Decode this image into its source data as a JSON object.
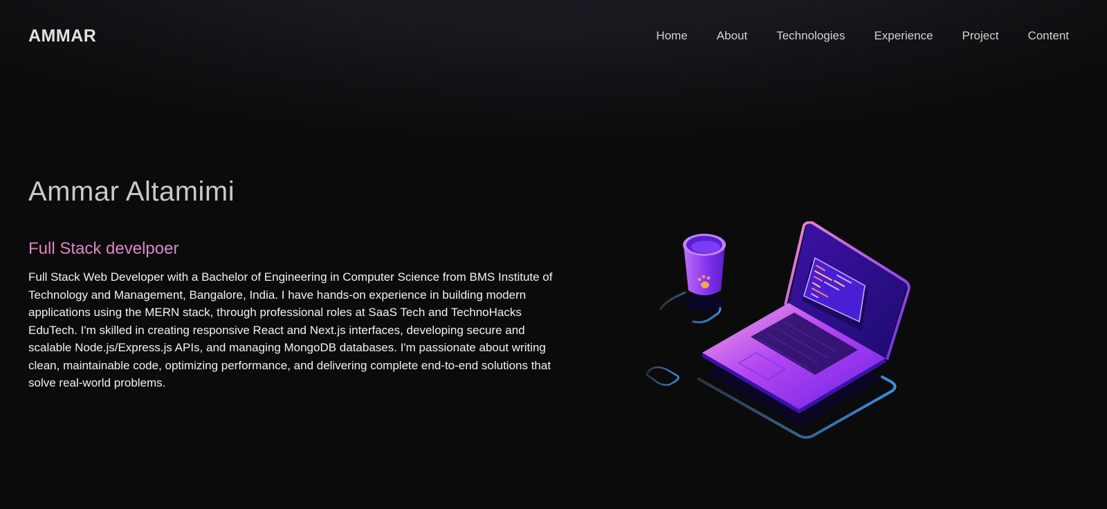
{
  "nav": {
    "brand": "AMMAR",
    "links": [
      "Home",
      "About",
      "Technologies",
      "Experience",
      "Project",
      "Content"
    ]
  },
  "hero": {
    "name": "Ammar Altamimi",
    "role": "Full Stack develpoer",
    "bio": "Full Stack Web Developer with a Bachelor of Engineering in Computer Science from BMS Institute of Technology and Management, Bangalore, India. I have hands-on experience in building modern applications using the MERN stack, through professional roles at SaaS Tech and TechnoHacks EduTech. I'm skilled in creating responsive React and Next.js interfaces, developing secure and scalable Node.js/Express.js APIs, and managing MongoDB databases. I'm passionate about writing clean, maintainable code, optimizing performance, and delivering complete end-to-end solutions that solve real-world problems."
  },
  "colors": {
    "background": "#0b0b0c",
    "role_gradient_start": "#e583c2",
    "role_gradient_end": "#a394d9",
    "illustration_purple": "#7b2cf5",
    "illustration_blue": "#3b8fe0"
  },
  "icons": {
    "illustration": "laptop-and-cup-illustration"
  }
}
